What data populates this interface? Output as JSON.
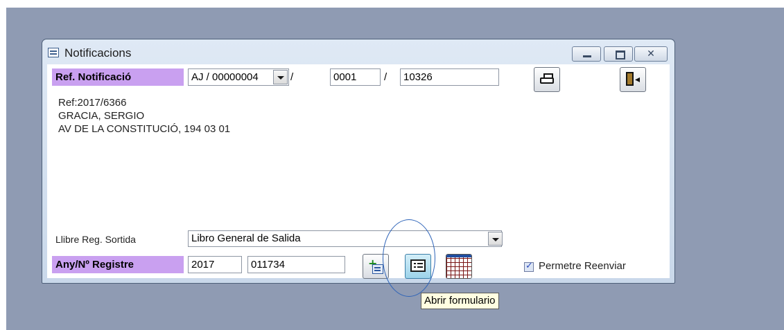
{
  "window": {
    "title": "Notificacions",
    "title_icon": "form-icon",
    "controls": [
      "minimize",
      "maximize",
      "close"
    ],
    "close_glyph": "✕"
  },
  "ref": {
    "label": "Ref. Notificació",
    "combo_value": "AJ / 00000004",
    "sep1": "/",
    "field2": "0001",
    "sep2": "/",
    "field3": "10326"
  },
  "toolbar": {
    "print_icon": "printer-icon",
    "exit_icon": "exit-door-icon"
  },
  "info": {
    "line1": "Ref:2017/6366",
    "line2": "GRACIA, SERGIO",
    "line3": "AV DE LA CONSTITUCIÓ,  194 03 01"
  },
  "register_book": {
    "label": "Llibre Reg. Sortida",
    "value": "Libro General de Salida"
  },
  "register": {
    "label": "Any/Nº Registre",
    "year": "2017",
    "number": "011734",
    "buttons": [
      "new-form-icon",
      "form-icon",
      "grid-icon"
    ]
  },
  "forward": {
    "label": "Permetre Reenviar",
    "checked": true
  },
  "tooltip": {
    "text": "Abrir formulario"
  },
  "colors": {
    "desktop": "#8f9bb3",
    "label_highlight": "#c9a0f0",
    "annotation_ring": "#2d63b8"
  }
}
